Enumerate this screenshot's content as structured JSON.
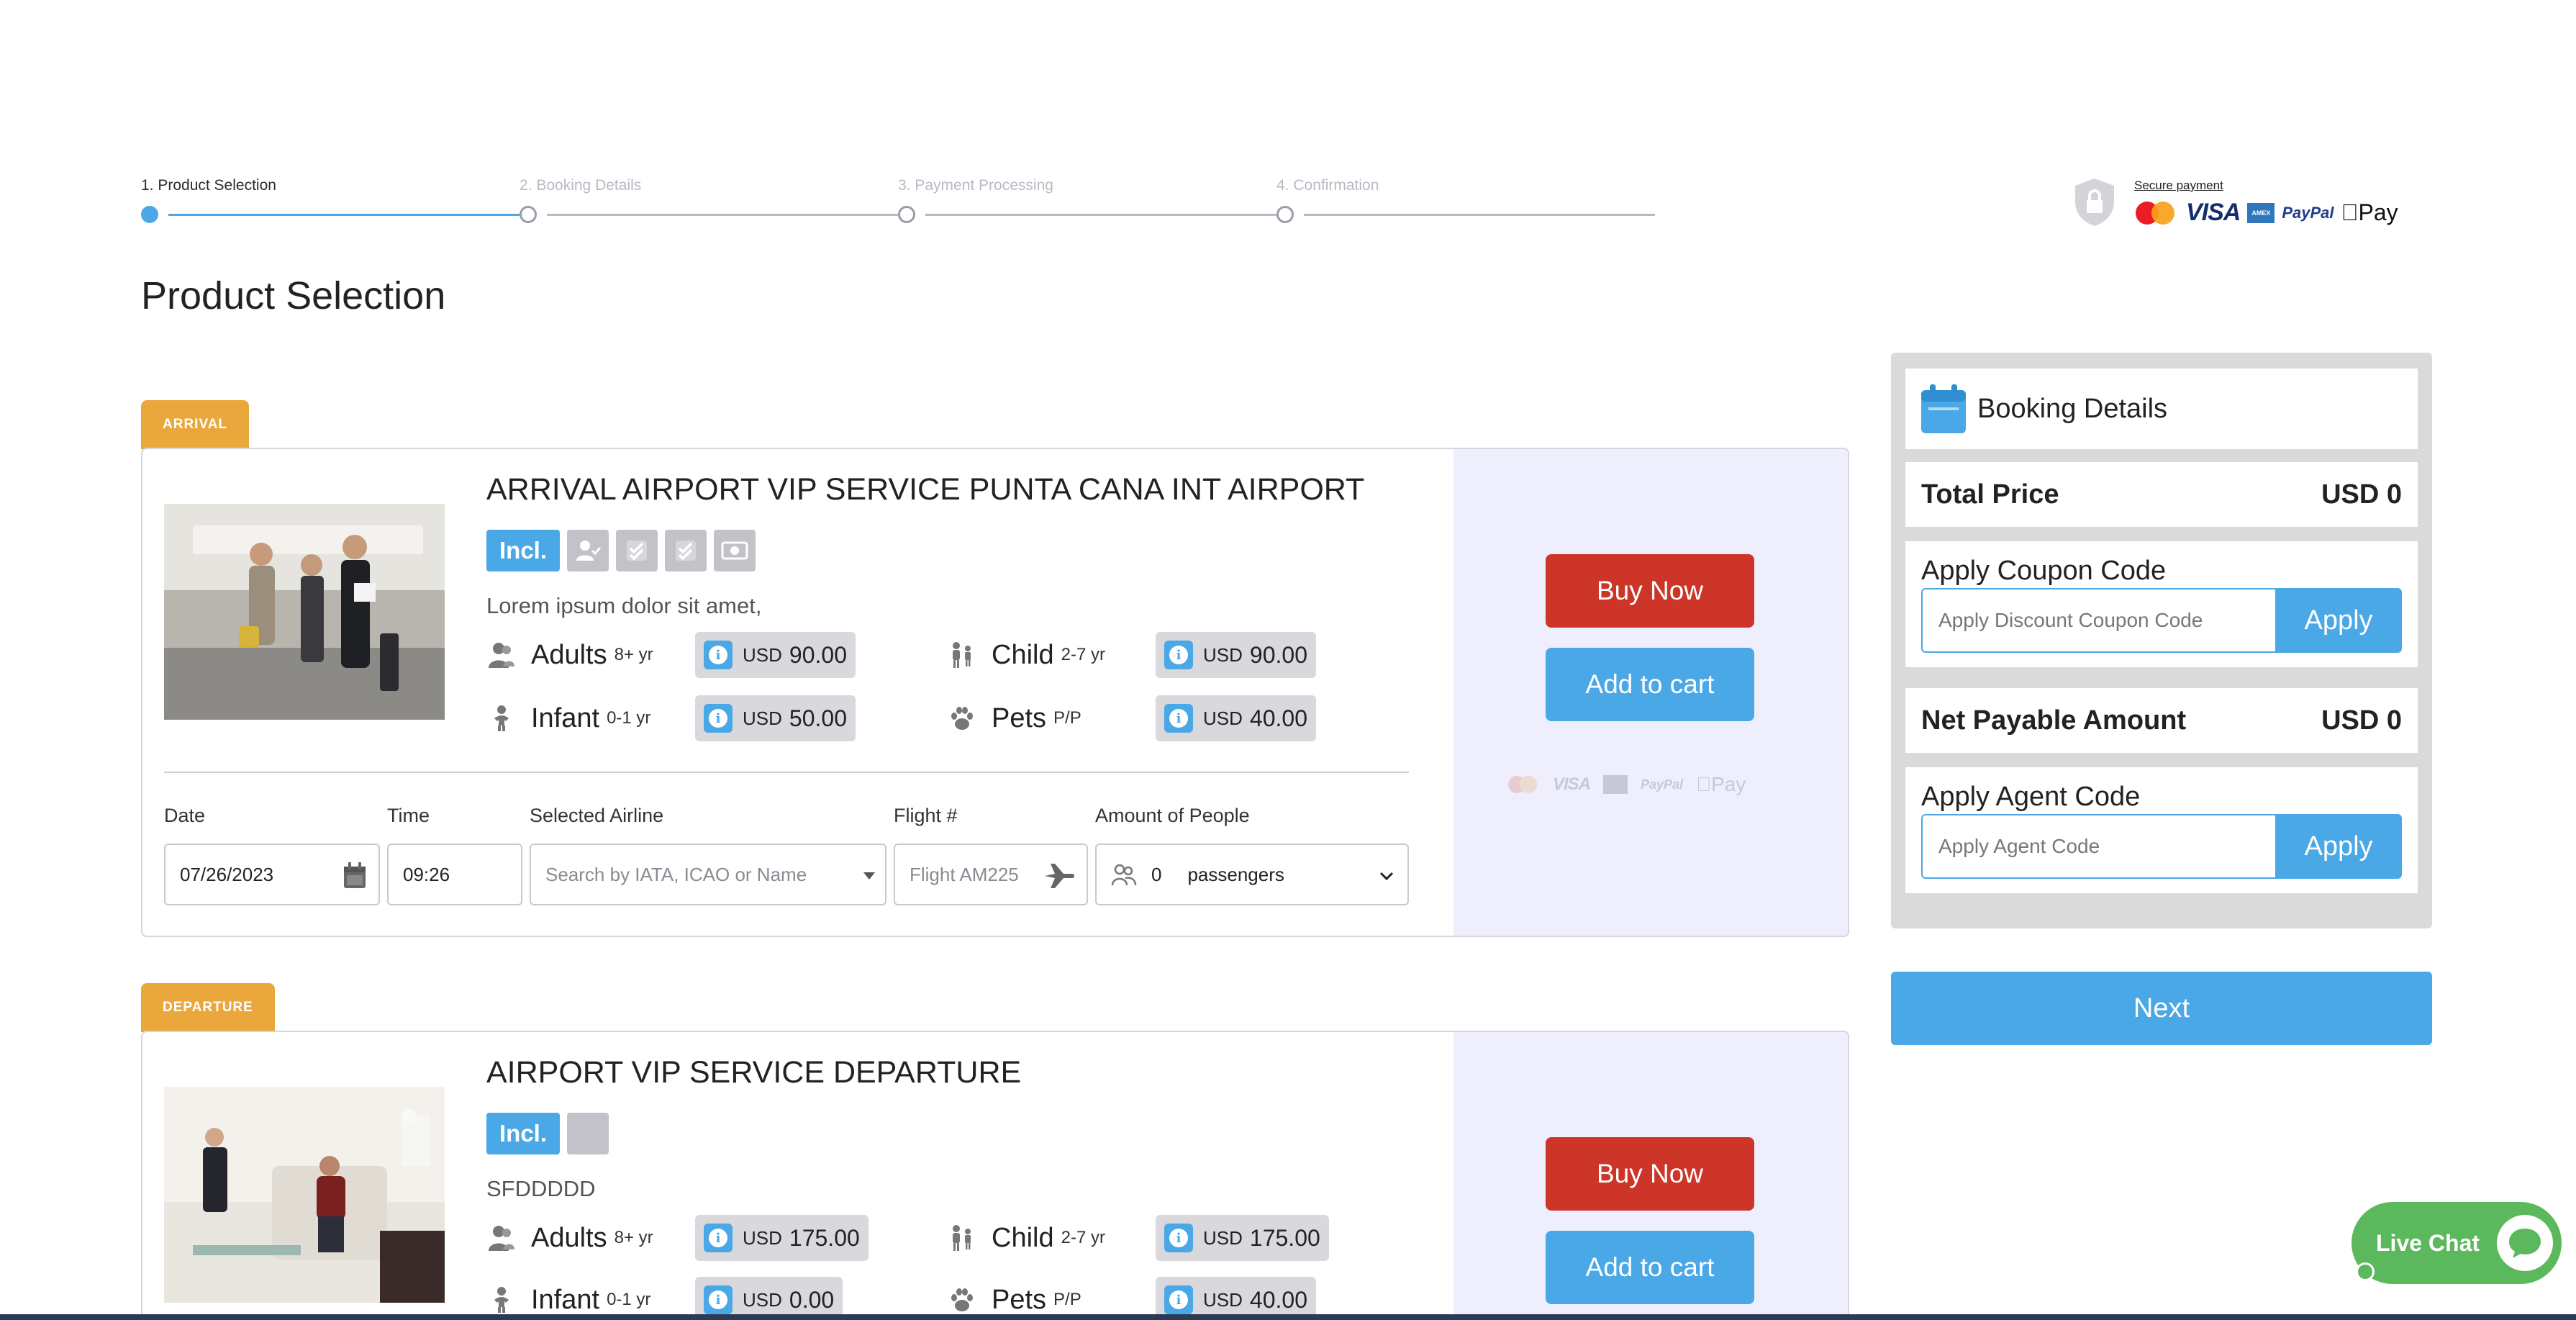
{
  "stepper": {
    "steps": [
      {
        "label": "1. Product Selection",
        "active": true
      },
      {
        "label": "2. Booking Details",
        "active": false
      },
      {
        "label": "3. Payment Processing",
        "active": false
      },
      {
        "label": "4. Confirmation",
        "active": false
      }
    ]
  },
  "secure_payment": {
    "title": "Secure payment",
    "logos": [
      "mastercard",
      "VISA",
      "AMEX",
      "PayPal",
      "Pay"
    ]
  },
  "page_title": "Product Selection",
  "products": [
    {
      "tag": "ARRIVAL",
      "title": "ARRIVAL AIRPORT VIP SERVICE PUNTA CANA INT AIRPORT",
      "badge": "Incl.",
      "description": "Lorem ipsum dolor sit amet,",
      "prices": [
        {
          "name": "Adults",
          "age": "8+ yr",
          "currency": "USD",
          "value": "90.00"
        },
        {
          "name": "Child",
          "age": "2-7 yr",
          "currency": "USD",
          "value": "90.00"
        },
        {
          "name": "Infant",
          "age": "0-1 yr",
          "currency": "USD",
          "value": "50.00"
        },
        {
          "name": "Pets",
          "age": "P/P",
          "currency": "USD",
          "value": "40.00"
        }
      ],
      "form": {
        "labels": {
          "date": "Date",
          "time": "Time",
          "airline": "Selected Airline",
          "flight": "Flight #",
          "people": "Amount of People"
        },
        "date_value": "07/26/2023",
        "time_value": "09:26",
        "airline_placeholder": "Search by IATA, ICAO or Name",
        "flight_placeholder": "Flight AM225",
        "people_count": "0",
        "people_unit": "passengers"
      },
      "buy_label": "Buy Now",
      "cart_label": "Add to cart"
    },
    {
      "tag": "DEPARTURE",
      "title": "AIRPORT VIP SERVICE DEPARTURE",
      "badge": "Incl.",
      "description": "SFDDDDD",
      "prices": [
        {
          "name": "Adults",
          "age": "8+ yr",
          "currency": "USD",
          "value": "175.00"
        },
        {
          "name": "Child",
          "age": "2-7 yr",
          "currency": "USD",
          "value": "175.00"
        },
        {
          "name": "Infant",
          "age": "0-1 yr",
          "currency": "USD",
          "value": "0.00"
        },
        {
          "name": "Pets",
          "age": "P/P",
          "currency": "USD",
          "value": "40.00"
        }
      ],
      "buy_label": "Buy Now",
      "cart_label": "Add to cart"
    }
  ],
  "booking": {
    "title": "Booking Details",
    "total_label": "Total Price",
    "total_value": "USD 0",
    "coupon_label": "Apply Coupon Code",
    "coupon_placeholder": "Apply Discount Coupon Code",
    "coupon_button": "Apply",
    "net_label": "Net Payable Amount",
    "net_value": "USD 0",
    "agent_label": "Apply Agent Code",
    "agent_placeholder": "Apply Agent Code",
    "agent_button": "Apply"
  },
  "next_label": "Next",
  "live_chat_label": "Live Chat",
  "colors": {
    "accent": "#4aa8e6",
    "buy": "#cc3528",
    "tag": "#eaa83c",
    "chat": "#5cb85c"
  }
}
